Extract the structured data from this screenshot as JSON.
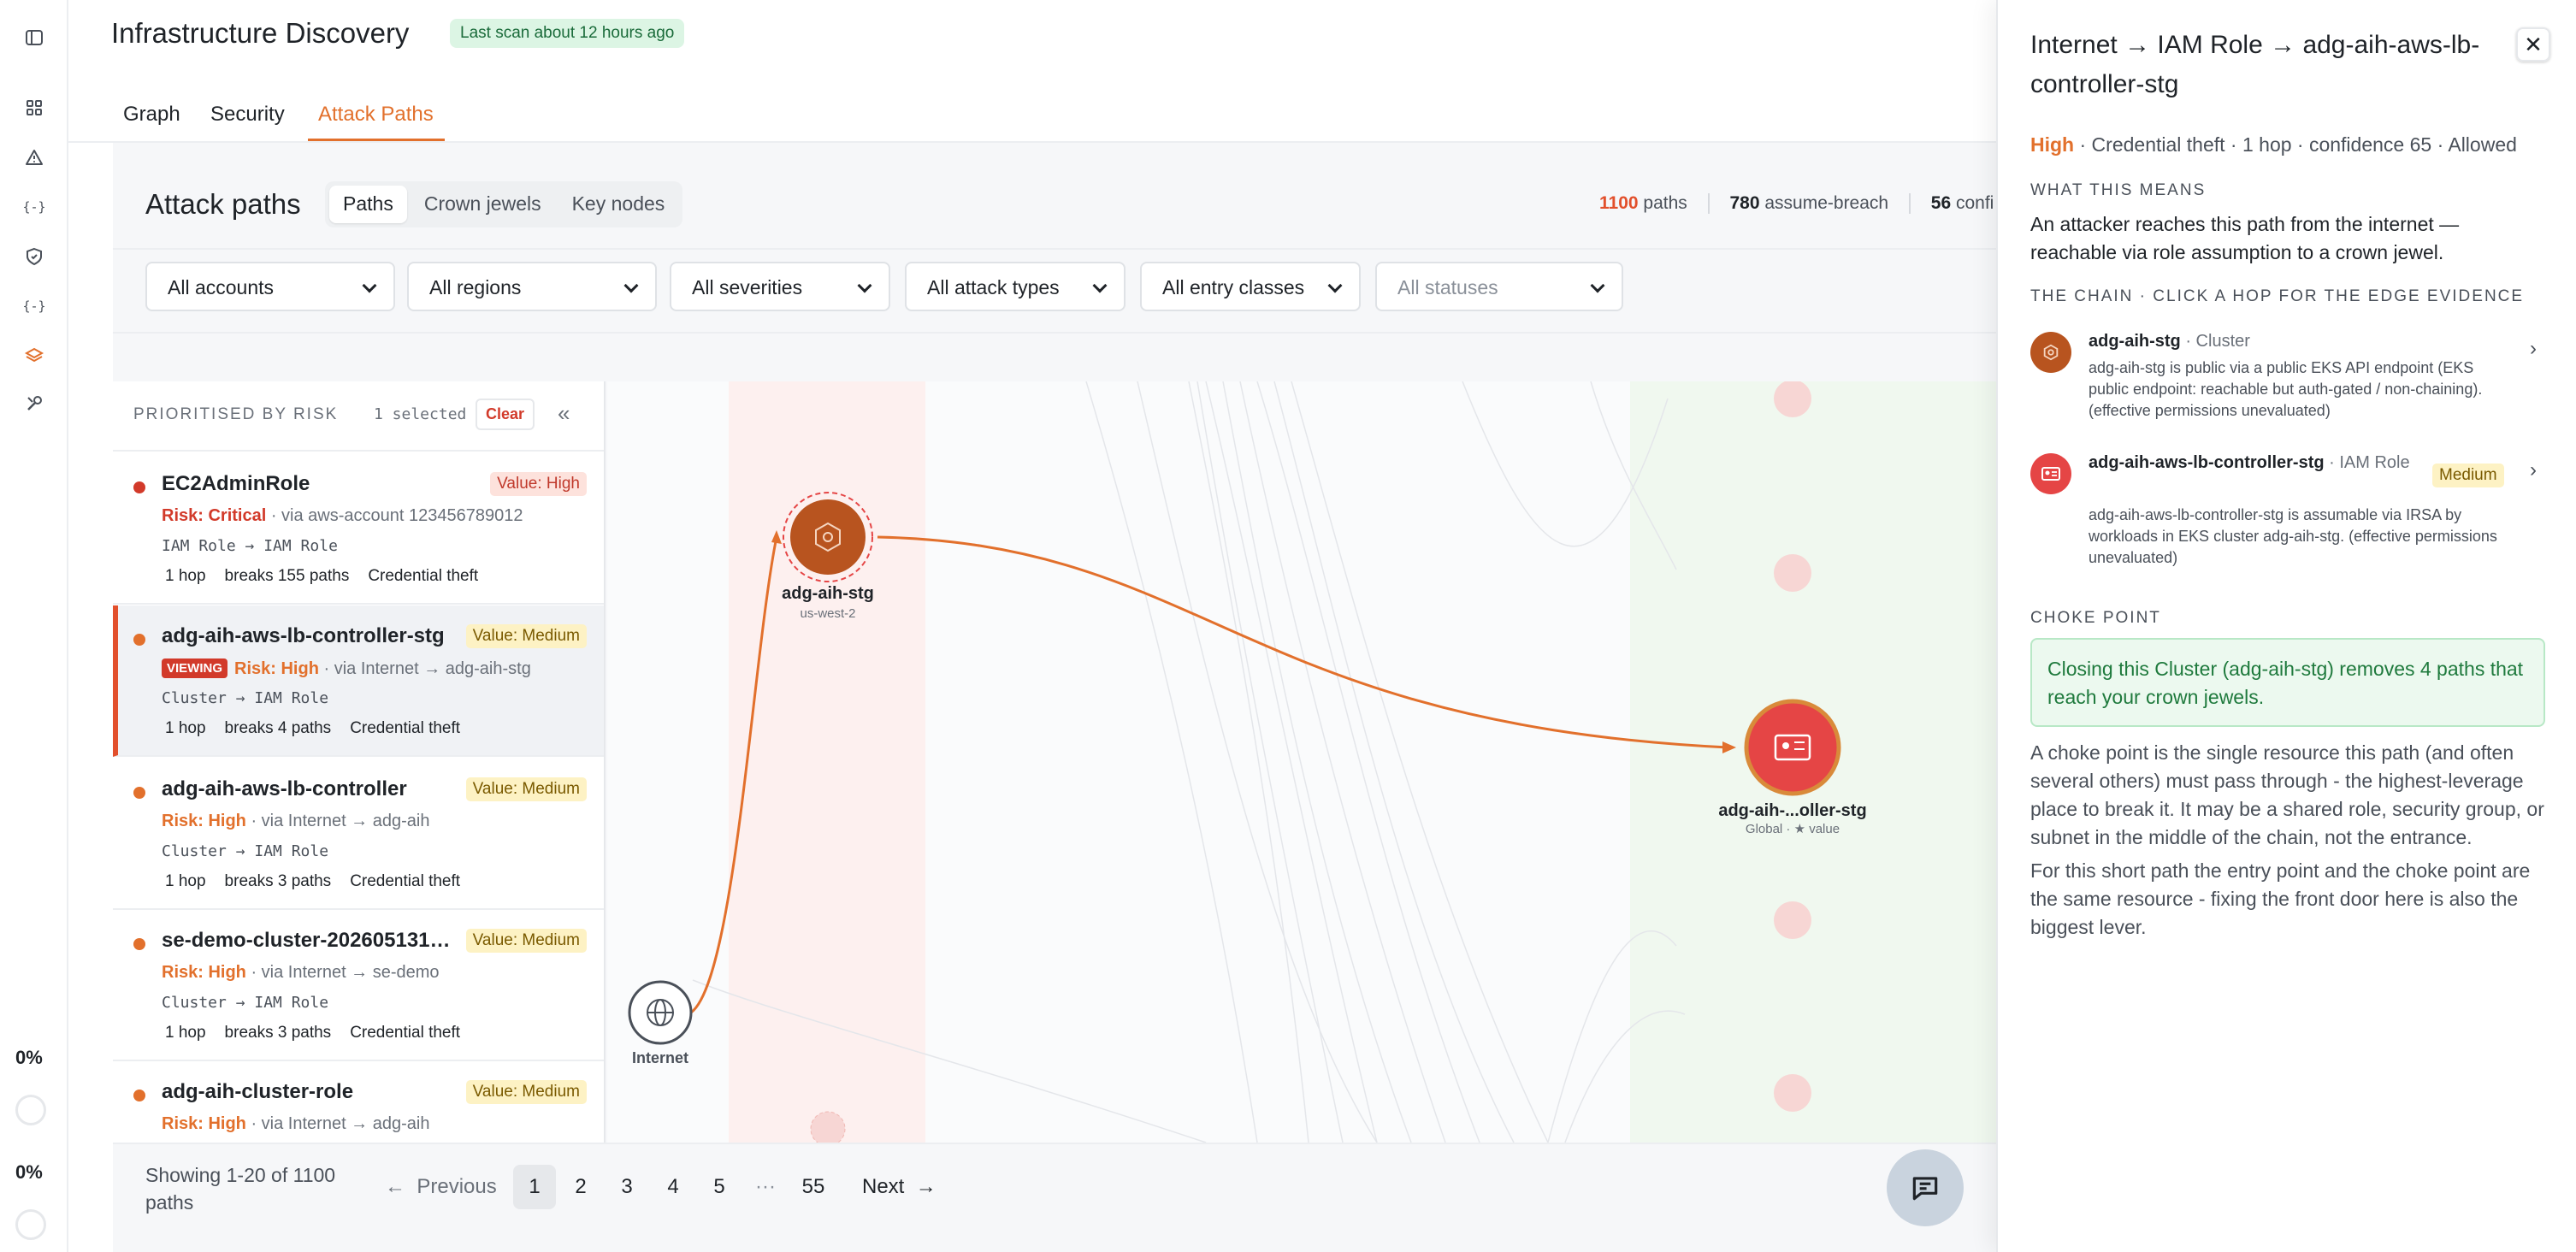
{
  "app": {
    "title": "Infrastructure Discovery",
    "scan_badge": "Last scan about 12 hours ago",
    "tabs": [
      {
        "label": "Graph"
      },
      {
        "label": "Security"
      },
      {
        "label": "Attack Paths"
      }
    ]
  },
  "rail": {
    "icons": [
      "sidebar-toggle-icon",
      "dashboard-icon",
      "alert-icon",
      "code-braces-icon",
      "shield-icon",
      "code-braces-icon",
      "layers-icon",
      "tools-icon"
    ],
    "pct1": "0%",
    "pct2": "0%"
  },
  "attack_paths": {
    "title": "Attack paths",
    "segments": [
      "Paths",
      "Crown jewels",
      "Key nodes"
    ],
    "stats": {
      "paths_count": "1100",
      "paths_label": "paths",
      "assume_breach_count": "780",
      "assume_breach_label": "assume-breach",
      "third_count": "56",
      "third_label": "confi"
    },
    "filters": [
      {
        "label": "All accounts"
      },
      {
        "label": "All regions"
      },
      {
        "label": "All severities"
      },
      {
        "label": "All attack types"
      },
      {
        "label": "All entry classes"
      },
      {
        "label": "All statuses"
      }
    ]
  },
  "list": {
    "header": "PRIORITISED BY RISK",
    "selected": "1 selected",
    "clear": "Clear",
    "collapse": "«",
    "items": [
      {
        "name": "EC2AdminRole",
        "value": "Value: High",
        "risk": "Risk: Critical",
        "via": " · via aws-account  123456789012",
        "flow": "IAM Role → IAM Role",
        "hops": "1 hop",
        "breaks": "breaks 155 paths",
        "type": "Credential theft",
        "viewing": ""
      },
      {
        "name": "adg-aih-aws-lb-controller-stg",
        "value": "Value: Medium",
        "risk": "Risk: High",
        "via": " · via Internet → adg-aih-stg",
        "flow": "Cluster → IAM Role",
        "hops": "1 hop",
        "breaks": "breaks 4 paths",
        "type": "Credential theft",
        "viewing": "VIEWING"
      },
      {
        "name": "adg-aih-aws-lb-controller",
        "value": "Value: Medium",
        "risk": "Risk: High",
        "via": " · via Internet → adg-aih",
        "flow": "Cluster → IAM Role",
        "hops": "1 hop",
        "breaks": "breaks 3 paths",
        "type": "Credential theft",
        "viewing": ""
      },
      {
        "name": "se-demo-cluster-202605131…",
        "value": "Value: Medium",
        "risk": "Risk: High",
        "via": " · via Internet → se-demo",
        "flow": "Cluster → IAM Role",
        "hops": "1 hop",
        "breaks": "breaks 3 paths",
        "type": "Credential theft",
        "viewing": ""
      },
      {
        "name": "adg-aih-cluster-role",
        "value": "Value: Medium",
        "risk": "Risk: High",
        "via": " · via Internet → adg-aih",
        "flow": "",
        "hops": "",
        "breaks": "",
        "type": "",
        "viewing": ""
      }
    ]
  },
  "graph": {
    "nodes": {
      "internet": {
        "label": "Internet"
      },
      "cluster": {
        "label": "adg-aih-stg",
        "sub": "us-west-2"
      },
      "role": {
        "label": "adg-aih-...oller-stg",
        "sub": "Global · ★ value"
      }
    }
  },
  "pager": {
    "info": "Showing 1-20 of 1100 paths",
    "prev": "Previous",
    "next": "Next",
    "pages": [
      "1",
      "2",
      "3",
      "4",
      "5",
      "···",
      "55"
    ]
  },
  "detail": {
    "title": "Internet → IAM Role → adg-aih-aws-lb-controller-stg",
    "close": "✕",
    "severity": "High",
    "meta": " · Credential theft · 1 hop · confidence 65 · Allowed",
    "what_heading": "WHAT THIS MEANS",
    "what_text": "An attacker reaches this path from the internet — reachable via role assumption to a crown jewel.",
    "chain_heading": "THE CHAIN · CLICK A HOP FOR THE EDGE EVIDENCE",
    "hops": [
      {
        "name": "adg-aih-stg",
        "type": " · Cluster",
        "badge": "",
        "desc": "adg-aih-stg is public via a public EKS API endpoint (EKS public endpoint: reachable but auth-gated / non-chaining). (effective permissions unevaluated)"
      },
      {
        "name": "adg-aih-aws-lb-controller-stg",
        "type": " · IAM Role",
        "badge": "Medium",
        "desc": "adg-aih-aws-lb-controller-stg is assumable via IRSA by workloads in EKS cluster adg-aih-stg. (effective permissions unevaluated)"
      }
    ],
    "choke_heading": "CHOKE POINT",
    "choke_text": "Closing this Cluster (adg-aih-stg) removes 4 paths that reach your crown jewels.",
    "para1": "A choke point is the single resource this path (and often several others) must pass through - the highest-leverage place to break it. It may be a shared role, security group, or subnet in the middle of the chain, not the entrance.",
    "para2": "For this short path the entry point and the choke point are the same resource - fixing the front door here is also the biggest lever."
  },
  "colors": {
    "accent": "#e2702c",
    "critical": "#d23a2a",
    "high": "#e2702c",
    "cluster_node": "#b8541f",
    "role_node": "#e54545"
  }
}
